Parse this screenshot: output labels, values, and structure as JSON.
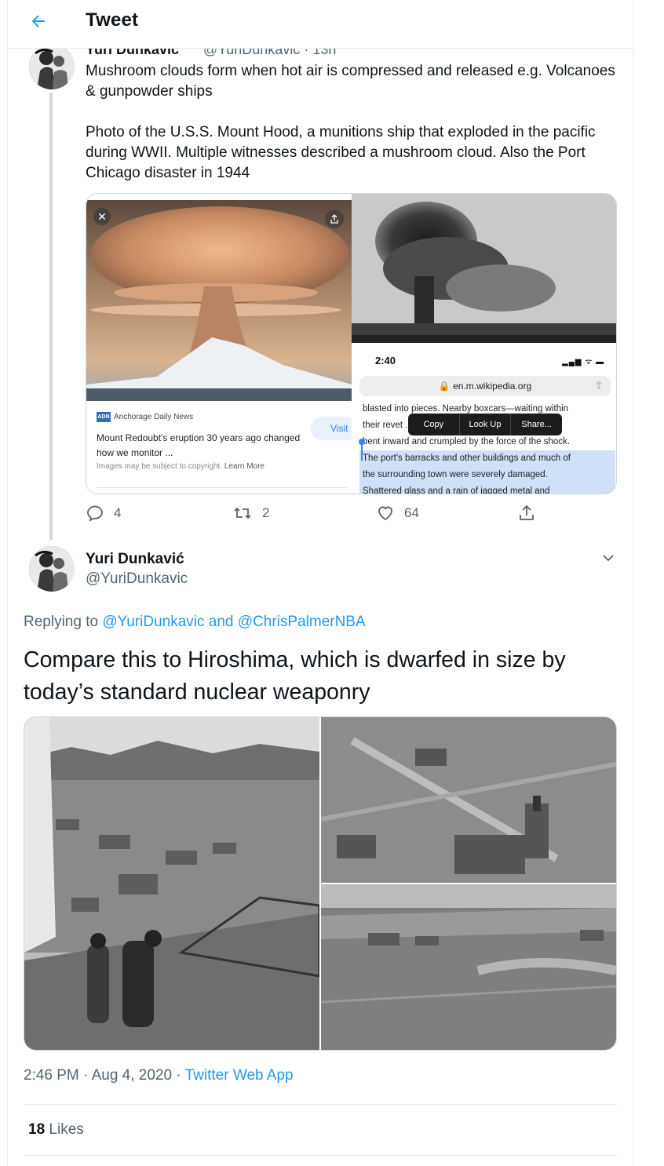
{
  "header": {
    "title": "Tweet",
    "back_icon": "arrow-left-icon"
  },
  "parent_tweet": {
    "author_name_cut": "Yuri Dunkavic",
    "author_handle_cut": "@YuriDunkavic · 13h",
    "text": "Mushroom clouds form when hot air is compressed and released e.g. Volcanoes & gunpowder ships\n\nPhoto of the U.S.S. Mount Hood, a munitions ship that exploded in the pacific during WWII. Multiple witnesses described a mushroom cloud. Also the Port Chicago disaster in 1944",
    "media": {
      "left": {
        "close_label": "✕",
        "source_logo": "ADN",
        "source": "Anchorage Daily News",
        "headline": "Mount Redoubt's eruption 30 years ago changed how we monitor ...",
        "copyright": "Images may be subject to copyright.",
        "learn_more": "Learn More",
        "visit_label": "Visit"
      },
      "right": {
        "time": "2:40",
        "status": "▂▄▆ ᯤ ▬",
        "url": "🔒 en.m.wikipedia.org",
        "text_lines": [
          "blasted into pieces. Nearby boxcars—waiting within",
          "their revet              ...t—were",
          "bent inward and crumpled by the force of the shock.",
          "The port's barracks and other buildings and much of",
          "the surrounding town were severely damaged.",
          "Shattered glass and a rain of jagged metal and"
        ],
        "context_menu": [
          "Copy",
          "Look Up",
          "Share..."
        ]
      }
    },
    "actions": {
      "replies": "4",
      "retweets": "2",
      "likes": "64"
    }
  },
  "main_tweet": {
    "author_name": "Yuri Dunkavić",
    "author_handle": "@YuriDunkavic",
    "replying_prefix": "Replying to",
    "replying_to_1": "@YuriDunkavic",
    "replying_and": "and",
    "replying_to_2": "@ChrisPalmerNBA",
    "text": "Compare this to Hiroshima, which is dwarfed in size by today’s standard nuclear weaponry",
    "timestamp": "2:46 PM · Aug 4, 2020 · ",
    "source_app": "Twitter Web App",
    "likes_count": "18",
    "likes_label": "Likes"
  },
  "colors": {
    "accent": "#1d9bf0",
    "muted": "#536471",
    "text": "#0f1419",
    "border": "#e6ecf0"
  }
}
